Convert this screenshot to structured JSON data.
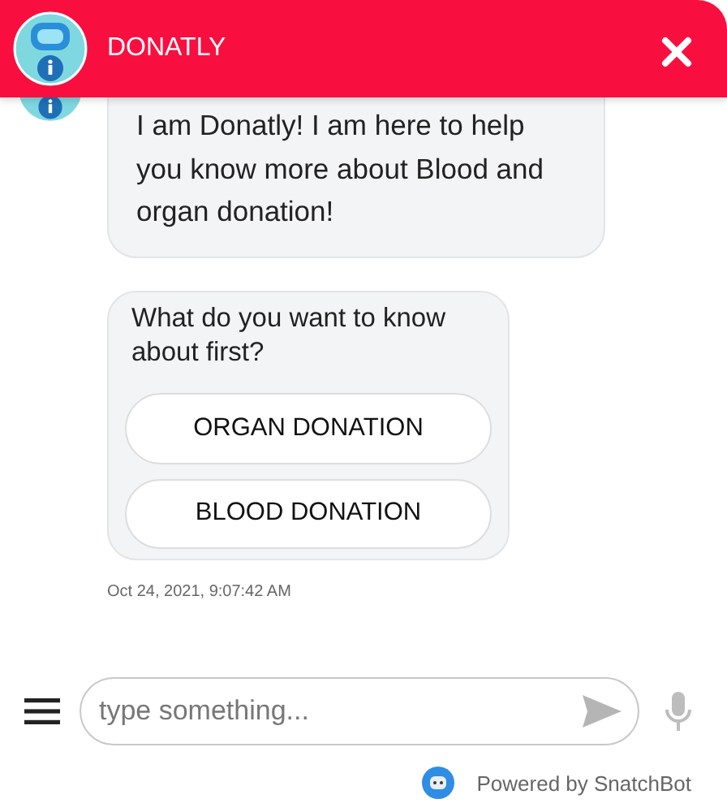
{
  "header": {
    "title": "DONATLY"
  },
  "messages": [
    {
      "kind": "text",
      "text": "I am Donatly! I am here to help you know more about Blood and organ donation!"
    },
    {
      "kind": "options",
      "text": "What do you want to know about first?",
      "buttons": [
        "ORGAN DONATION",
        "BLOOD DONATION"
      ]
    }
  ],
  "timestamp": "Oct 24, 2021, 9:07:42 AM",
  "composer": {
    "placeholder": "type something..."
  },
  "footer": {
    "text": "Powered by SnatchBot"
  }
}
